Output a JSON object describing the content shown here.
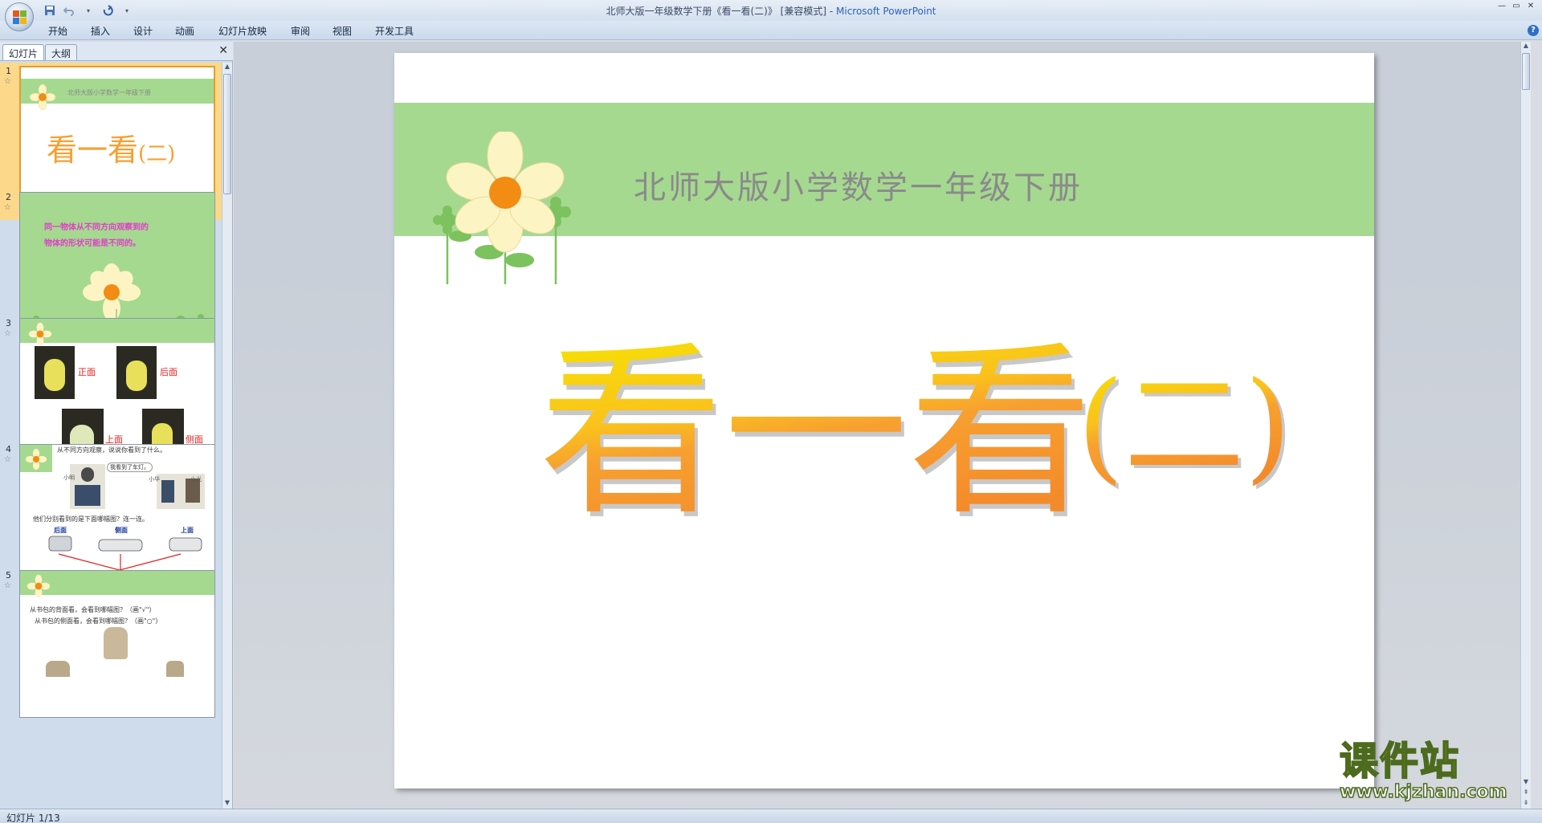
{
  "window": {
    "title_prefix": "北师大版一年级数学下册《看一看(二)》 [兼容模式] - ",
    "title_app": "Microsoft PowerPoint"
  },
  "quick_access": {
    "save_icon": "save-icon",
    "undo_icon": "undo-icon",
    "redo_icon": "redo-icon",
    "customize_icon": "chevron-down-icon"
  },
  "ribbon": {
    "tabs": [
      "开始",
      "插入",
      "设计",
      "动画",
      "幻灯片放映",
      "审阅",
      "视图",
      "开发工具"
    ]
  },
  "pane": {
    "tab_slides": "幻灯片",
    "tab_outline": "大纲"
  },
  "thumbnails": [
    {
      "num": "1",
      "banner_text": "北师大版小学数学一年级下册",
      "title": "看一看",
      "title_paren": "(二)"
    },
    {
      "num": "2",
      "line1": "同一物体从不同方向观察到的",
      "line2": "物体的形状可能是不同的。"
    },
    {
      "num": "3",
      "label_front": "正面",
      "label_back": "后面",
      "label_top": "上面",
      "label_side": "侧面"
    },
    {
      "num": "4",
      "q1": "从不同方向观察，说说你看到了什么。",
      "bubble": "我看到了车灯。",
      "q2": "他们分别看到的是下面哪幅图？连一连。",
      "h1": "后面",
      "h2": "侧面",
      "h3": "上面",
      "n1": "小明",
      "n2": "小华",
      "n3": "小光",
      "n4": "小明",
      "n5": "小光"
    },
    {
      "num": "5",
      "q1": "从书包的背面看，会看到哪幅图？（画\"√\"）",
      "q2": "从书包的侧面看，会看到哪幅图？（画\"○\"）"
    }
  ],
  "slide": {
    "subtitle": "北师大版小学数学一年级下册",
    "title_main": "看一看",
    "title_paren": "(二)"
  },
  "status": {
    "slide_info": "幻灯片 1/13"
  },
  "watermark": {
    "text": "课件站",
    "url": "www.kjzhan.com"
  },
  "colors": {
    "banner_green": "#a5d990",
    "title_orange": "#f7a030",
    "title_yellow": "#f5e600",
    "petal": "#fdf4c4",
    "flower_center": "#f28c12",
    "selection": "#fbd88a"
  }
}
